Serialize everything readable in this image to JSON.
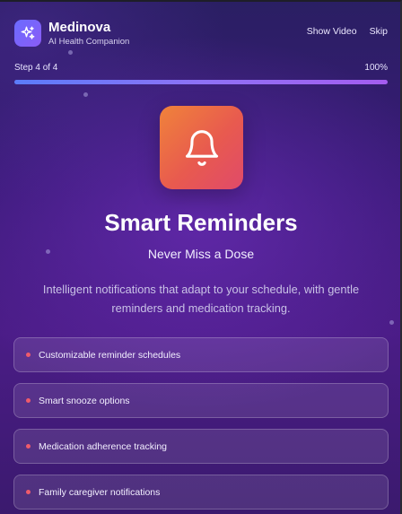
{
  "brand": {
    "name": "Medinova",
    "tagline": "AI Health Companion",
    "logo_icon": "sparkles-icon",
    "logo_color": "#7a63ff"
  },
  "header": {
    "show_video_label": "Show Video",
    "skip_label": "Skip"
  },
  "progress": {
    "step_text": "Step 4 of 4",
    "percent_text": "100%",
    "value": 1.0
  },
  "hero": {
    "icon": "bell-icon",
    "title": "Smart Reminders",
    "subtitle": "Never Miss a Dose",
    "description": "Intelligent notifications that adapt to your schedule, with gentle reminders and medication tracking."
  },
  "features": [
    {
      "label": "Customizable reminder schedules"
    },
    {
      "label": "Smart snooze options"
    },
    {
      "label": "Medication adherence tracking"
    },
    {
      "label": "Family caregiver notifications"
    }
  ],
  "colors": {
    "accent_gradient_start": "#f0833a",
    "accent_gradient_end": "#e04a6a",
    "progress_start": "#5b7cfa",
    "progress_end": "#a45cf0",
    "bullet": "#ef5b6b"
  }
}
